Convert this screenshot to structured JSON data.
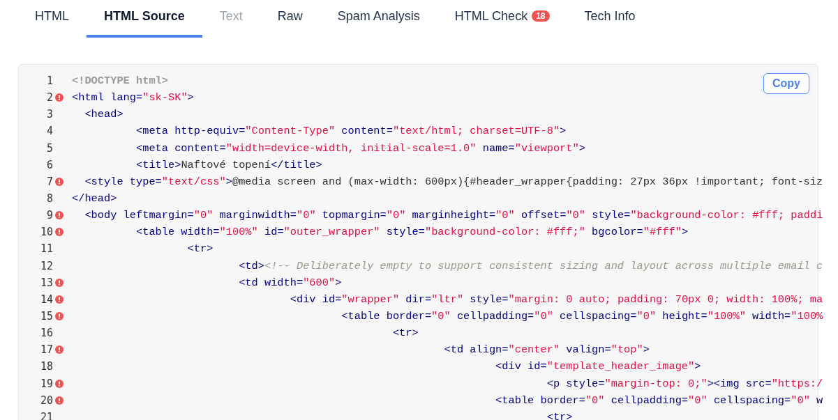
{
  "tabs": [
    {
      "label": "HTML",
      "selected": false,
      "disabled": false
    },
    {
      "label": "HTML Source",
      "selected": true,
      "disabled": false
    },
    {
      "label": "Text",
      "selected": false,
      "disabled": true
    },
    {
      "label": "Raw",
      "selected": false,
      "disabled": false
    },
    {
      "label": "Spam Analysis",
      "selected": false,
      "disabled": false
    },
    {
      "label": "HTML Check",
      "selected": false,
      "disabled": false,
      "badge": "18"
    },
    {
      "label": "Tech Info",
      "selected": false,
      "disabled": false
    }
  ],
  "copy_button": "Copy",
  "code_lines": [
    {
      "number": "1",
      "error": false,
      "tokens": [
        {
          "kind": "doctype",
          "text": "<!DOCTYPE html>"
        }
      ]
    },
    {
      "number": "2",
      "error": true,
      "tokens": [
        {
          "kind": "tag",
          "text": "<html lang="
        },
        {
          "kind": "string",
          "text": "\"sk-SK\""
        },
        {
          "kind": "tag",
          "text": ">"
        }
      ]
    },
    {
      "number": "3",
      "error": false,
      "tokens": [
        {
          "kind": "tag",
          "text": "  <head>"
        }
      ]
    },
    {
      "number": "4",
      "error": false,
      "tokens": [
        {
          "kind": "tag",
          "text": "          <meta http-equiv="
        },
        {
          "kind": "string",
          "text": "\"Content-Type\""
        },
        {
          "kind": "tag",
          "text": " content="
        },
        {
          "kind": "string",
          "text": "\"text/html; charset=UTF-8\""
        },
        {
          "kind": "tag",
          "text": ">"
        }
      ]
    },
    {
      "number": "5",
      "error": false,
      "tokens": [
        {
          "kind": "tag",
          "text": "          <meta content="
        },
        {
          "kind": "string",
          "text": "\"width=device-width, initial-scale=1.0\""
        },
        {
          "kind": "tag",
          "text": " name="
        },
        {
          "kind": "string",
          "text": "\"viewport\""
        },
        {
          "kind": "tag",
          "text": ">"
        }
      ]
    },
    {
      "number": "6",
      "error": false,
      "tokens": [
        {
          "kind": "tag",
          "text": "          <title>"
        },
        {
          "kind": "text",
          "text": "Naftové topení"
        },
        {
          "kind": "tag",
          "text": "</title>"
        }
      ]
    },
    {
      "number": "7",
      "error": true,
      "tokens": [
        {
          "kind": "tag",
          "text": "  <style type="
        },
        {
          "kind": "string",
          "text": "\"text/css\""
        },
        {
          "kind": "tag",
          "text": ">"
        },
        {
          "kind": "text",
          "text": "@media screen and (max-width: 600px){#header_wrapper{padding: 27px 36px !important; font-siz"
        }
      ]
    },
    {
      "number": "8",
      "error": false,
      "tokens": [
        {
          "kind": "tag",
          "text": "</head>"
        }
      ]
    },
    {
      "number": "9",
      "error": true,
      "tokens": [
        {
          "kind": "tag",
          "text": "  <body leftmargin="
        },
        {
          "kind": "string",
          "text": "\"0\""
        },
        {
          "kind": "tag",
          "text": " marginwidth="
        },
        {
          "kind": "string",
          "text": "\"0\""
        },
        {
          "kind": "tag",
          "text": " topmargin="
        },
        {
          "kind": "string",
          "text": "\"0\""
        },
        {
          "kind": "tag",
          "text": " marginheight="
        },
        {
          "kind": "string",
          "text": "\"0\""
        },
        {
          "kind": "tag",
          "text": " offset="
        },
        {
          "kind": "string",
          "text": "\"0\""
        },
        {
          "kind": "tag",
          "text": " style="
        },
        {
          "kind": "string",
          "text": "\"background-color: #fff; paddi"
        }
      ]
    },
    {
      "number": "10",
      "error": true,
      "tokens": [
        {
          "kind": "tag",
          "text": "          <table width="
        },
        {
          "kind": "string",
          "text": "\"100%\""
        },
        {
          "kind": "tag",
          "text": " id="
        },
        {
          "kind": "string",
          "text": "\"outer_wrapper\""
        },
        {
          "kind": "tag",
          "text": " style="
        },
        {
          "kind": "string",
          "text": "\"background-color: #fff;\""
        },
        {
          "kind": "tag",
          "text": " bgcolor="
        },
        {
          "kind": "string",
          "text": "\"#fff\""
        },
        {
          "kind": "tag",
          "text": ">"
        }
      ]
    },
    {
      "number": "11",
      "error": false,
      "tokens": [
        {
          "kind": "tag",
          "text": "                  <tr>"
        }
      ]
    },
    {
      "number": "12",
      "error": false,
      "tokens": [
        {
          "kind": "tag",
          "text": "                          <td>"
        },
        {
          "kind": "comment",
          "text": "<!-- Deliberately empty to support consistent sizing and layout across multiple email c"
        }
      ]
    },
    {
      "number": "13",
      "error": true,
      "tokens": [
        {
          "kind": "tag",
          "text": "                          <td width="
        },
        {
          "kind": "string",
          "text": "\"600\""
        },
        {
          "kind": "tag",
          "text": ">"
        }
      ]
    },
    {
      "number": "14",
      "error": true,
      "tokens": [
        {
          "kind": "tag",
          "text": "                                  <div id="
        },
        {
          "kind": "string",
          "text": "\"wrapper\""
        },
        {
          "kind": "tag",
          "text": " dir="
        },
        {
          "kind": "string",
          "text": "\"ltr\""
        },
        {
          "kind": "tag",
          "text": " style="
        },
        {
          "kind": "string",
          "text": "\"margin: 0 auto; padding: 70px 0; width: 100%; ma"
        }
      ]
    },
    {
      "number": "15",
      "error": true,
      "tokens": [
        {
          "kind": "tag",
          "text": "                                          <table border="
        },
        {
          "kind": "string",
          "text": "\"0\""
        },
        {
          "kind": "tag",
          "text": " cellpadding="
        },
        {
          "kind": "string",
          "text": "\"0\""
        },
        {
          "kind": "tag",
          "text": " cellspacing="
        },
        {
          "kind": "string",
          "text": "\"0\""
        },
        {
          "kind": "tag",
          "text": " height="
        },
        {
          "kind": "string",
          "text": "\"100%\""
        },
        {
          "kind": "tag",
          "text": " width="
        },
        {
          "kind": "string",
          "text": "\"100%"
        }
      ]
    },
    {
      "number": "16",
      "error": false,
      "tokens": [
        {
          "kind": "tag",
          "text": "                                                  <tr>"
        }
      ]
    },
    {
      "number": "17",
      "error": true,
      "tokens": [
        {
          "kind": "tag",
          "text": "                                                          <td align="
        },
        {
          "kind": "string",
          "text": "\"center\""
        },
        {
          "kind": "tag",
          "text": " valign="
        },
        {
          "kind": "string",
          "text": "\"top\""
        },
        {
          "kind": "tag",
          "text": ">"
        }
      ]
    },
    {
      "number": "18",
      "error": false,
      "tokens": [
        {
          "kind": "tag",
          "text": "                                                                  <div id="
        },
        {
          "kind": "string",
          "text": "\"template_header_image\""
        },
        {
          "kind": "tag",
          "text": ">"
        }
      ]
    },
    {
      "number": "19",
      "error": true,
      "tokens": [
        {
          "kind": "tag",
          "text": "                                                                          <p style="
        },
        {
          "kind": "string",
          "text": "\"margin-top: 0;\""
        },
        {
          "kind": "tag",
          "text": "><img src="
        },
        {
          "kind": "string",
          "text": "\"https:/"
        }
      ]
    },
    {
      "number": "20",
      "error": true,
      "tokens": [
        {
          "kind": "tag",
          "text": "                                                                  <table border="
        },
        {
          "kind": "string",
          "text": "\"0\""
        },
        {
          "kind": "tag",
          "text": " cellpadding="
        },
        {
          "kind": "string",
          "text": "\"0\""
        },
        {
          "kind": "tag",
          "text": " cellspacing="
        },
        {
          "kind": "string",
          "text": "\"0\""
        },
        {
          "kind": "tag",
          "text": " w"
        }
      ]
    },
    {
      "number": "21",
      "error": false,
      "tokens": [
        {
          "kind": "tag",
          "text": "                                                                          <tr>"
        }
      ]
    }
  ]
}
